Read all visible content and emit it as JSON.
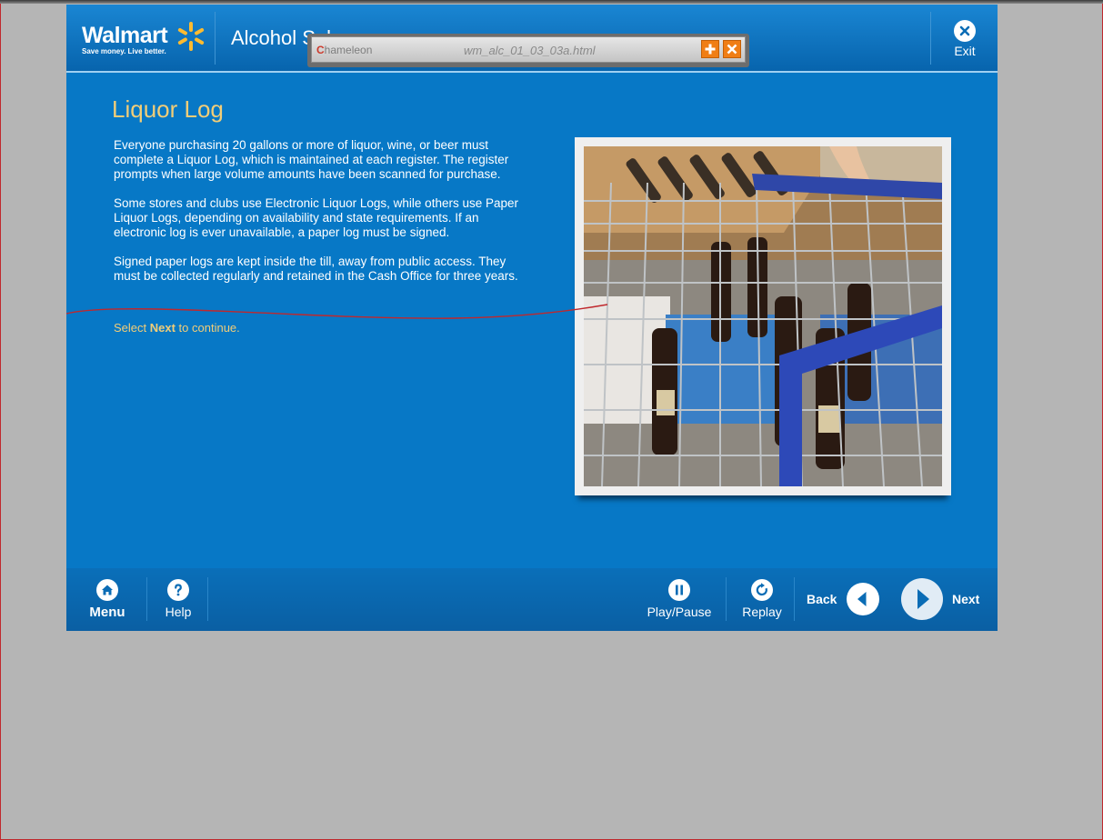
{
  "header": {
    "logo_text": "Walmart",
    "logo_tagline": "Save money. Live better.",
    "course_title": "Alcohol Sales",
    "exit_label": "Exit"
  },
  "popup": {
    "brand": "hameleon",
    "brand_initial": "C",
    "filename": "wm_alc_01_03_03a.html"
  },
  "content": {
    "title": "Liquor Log",
    "paragraphs": [
      "Everyone purchasing 20 gallons or more of liquor, wine, or beer must complete a Liquor Log, which is maintained at each register.  The register prompts when large volume amounts have been scanned for purchase.",
      "Some stores and clubs use Electronic Liquor Logs, while others use Paper Liquor Logs, depending on availability and state requirements.  If an electronic log is ever unavailable, a paper log must be signed.",
      "Signed paper logs are kept inside the till, away from public access.  They must be collected regularly and retained in the Cash Office for three years."
    ],
    "select_prefix": "Select ",
    "select_bold": "Next",
    "select_suffix": " to continue."
  },
  "footer": {
    "menu_label": "Menu",
    "help_label": "Help",
    "playpause_label": "Play/Pause",
    "replay_label": "Replay",
    "back_label": "Back",
    "next_label": "Next"
  },
  "colors": {
    "content_bg": "#0778c6",
    "title_gold": "#f1cd78",
    "spark_yellow": "#fdbb30",
    "page_bg": "#b5b5b5"
  }
}
